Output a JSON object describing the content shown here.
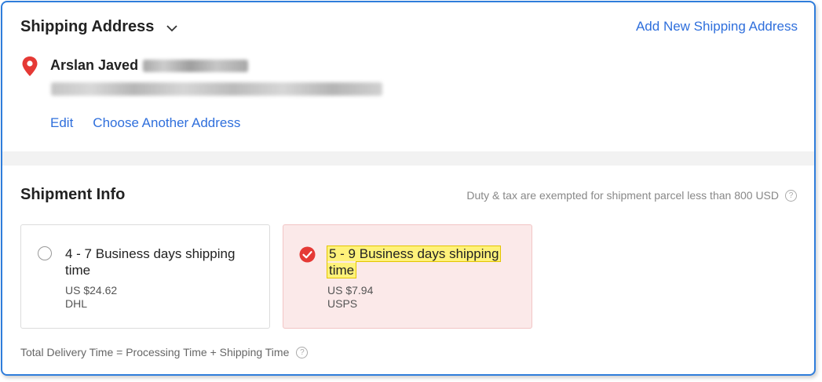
{
  "address": {
    "title": "Shipping Address",
    "add_link": "Add New Shipping Address",
    "name": "Arslan Javed",
    "actions": {
      "edit": "Edit",
      "choose": "Choose Another Address"
    }
  },
  "shipment": {
    "title": "Shipment Info",
    "duty_note": "Duty & tax are exempted for shipment parcel less than 800 USD",
    "options": [
      {
        "title": "4 - 7 Business days shipping time",
        "price": "US $24.62",
        "carrier": "DHL",
        "selected": false
      },
      {
        "title": "5 - 9 Business days shipping time",
        "price": "US $7.94",
        "carrier": "USPS",
        "selected": true
      }
    ],
    "total_note": "Total Delivery Time = Processing Time + Shipping Time"
  },
  "colors": {
    "link": "#2f6fdc",
    "frame_border": "#2f7ddb",
    "selected_bg": "#fbe9e9",
    "accent_red": "#e53935",
    "highlight": "#fff27a"
  },
  "icons": {
    "chevron": "chevron-down-icon",
    "pin": "location-pin-icon",
    "radio": "radio-unchecked-icon",
    "check": "check-circle-icon",
    "help": "help-circle-icon",
    "help_glyph": "?"
  }
}
